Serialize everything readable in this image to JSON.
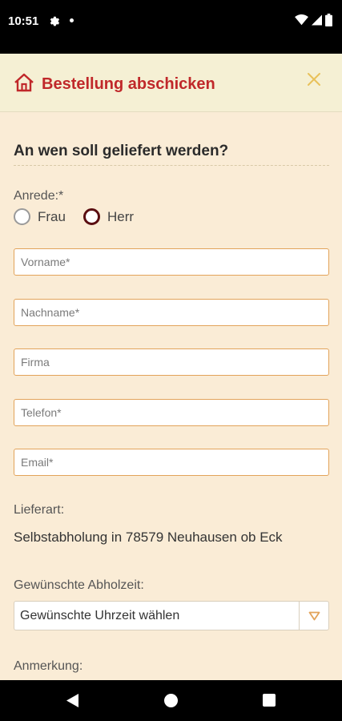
{
  "status_bar": {
    "time": "10:51",
    "icons": [
      "gear-icon",
      "notification-dot-icon",
      "wifi-icon",
      "cell-signal-icon",
      "battery-icon"
    ]
  },
  "header": {
    "title": "Bestellung abschicken",
    "icon": "home-icon",
    "close_icon": "close-icon",
    "title_color": "#c0282a",
    "close_color": "#e8c15a"
  },
  "form": {
    "section_title": "An wen soll geliefert werden?",
    "salutation_label": "Anrede:*",
    "salutation_options": [
      {
        "label": "Frau",
        "checked": false
      },
      {
        "label": "Herr",
        "checked": true
      }
    ],
    "fields": {
      "vorname": {
        "placeholder": "Vorname*",
        "value": ""
      },
      "nachname": {
        "placeholder": "Nachname*",
        "value": ""
      },
      "firma": {
        "placeholder": "Firma",
        "value": ""
      },
      "telefon": {
        "placeholder": "Telefon*",
        "value": ""
      },
      "email": {
        "placeholder": "Email*",
        "value": ""
      }
    },
    "delivery_label": "Lieferart:",
    "delivery_value": "Selbstabholung in 78579 Neuhausen ob Eck",
    "pickup_time_label": "Gewünschte Abholzeit:",
    "pickup_time_select": "Gewünschte Uhrzeit wählen",
    "remark_label": "Anmerkung:"
  },
  "nav_bar": {
    "icons": [
      "back-icon",
      "home-circle-icon",
      "recents-icon"
    ]
  }
}
